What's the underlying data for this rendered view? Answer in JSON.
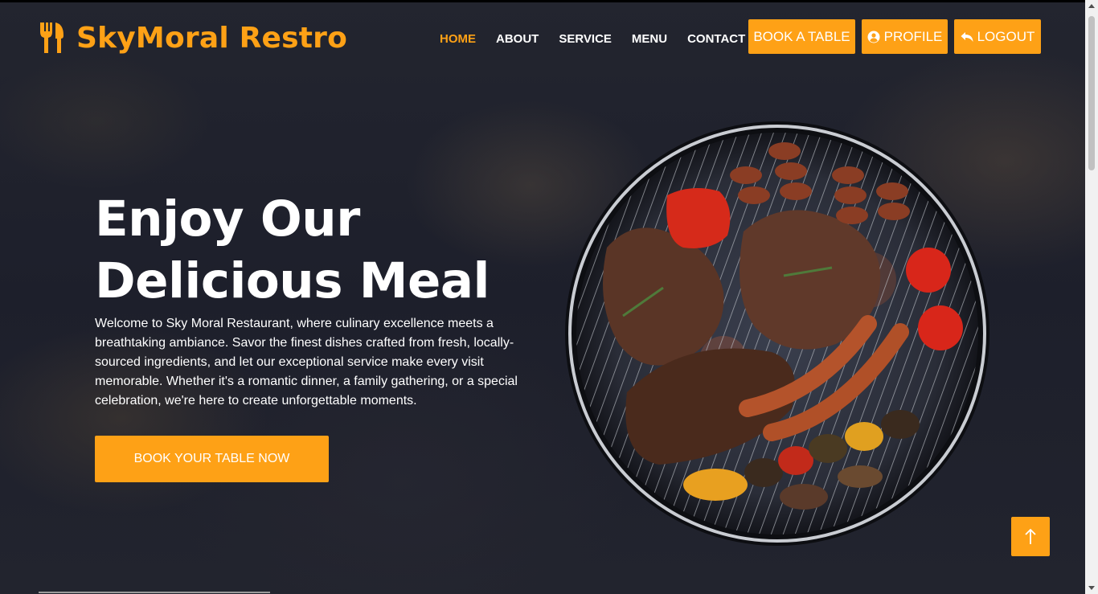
{
  "brand": {
    "name": "SkyMoral Restro",
    "icon": "utensils-icon"
  },
  "nav": {
    "items": [
      {
        "label": "HOME",
        "active": true
      },
      {
        "label": "ABOUT",
        "active": false
      },
      {
        "label": "SERVICE",
        "active": false
      },
      {
        "label": "MENU",
        "active": false
      },
      {
        "label": "CONTACT",
        "active": false
      }
    ]
  },
  "header_buttons": {
    "book": "BOOK A TABLE",
    "profile": "PROFILE",
    "logout": "LOGOUT"
  },
  "hero": {
    "title_line1": "Enjoy Our",
    "title_line2": "Delicious Meal",
    "description": "Welcome to Sky Moral Restaurant, where culinary excellence meets a breathtaking ambiance. Savor the finest dishes crafted from fresh, locally-sourced ingredients, and let our exceptional service make every visit memorable. Whether it's a romantic dinner, a family gathering, or a special celebration, we're here to create unforgettable moments.",
    "cta": "BOOK YOUR TABLE NOW"
  },
  "back_to_top_icon": "arrow-up-icon",
  "colors": {
    "accent": "#FEA116",
    "background": "#1f2130"
  }
}
